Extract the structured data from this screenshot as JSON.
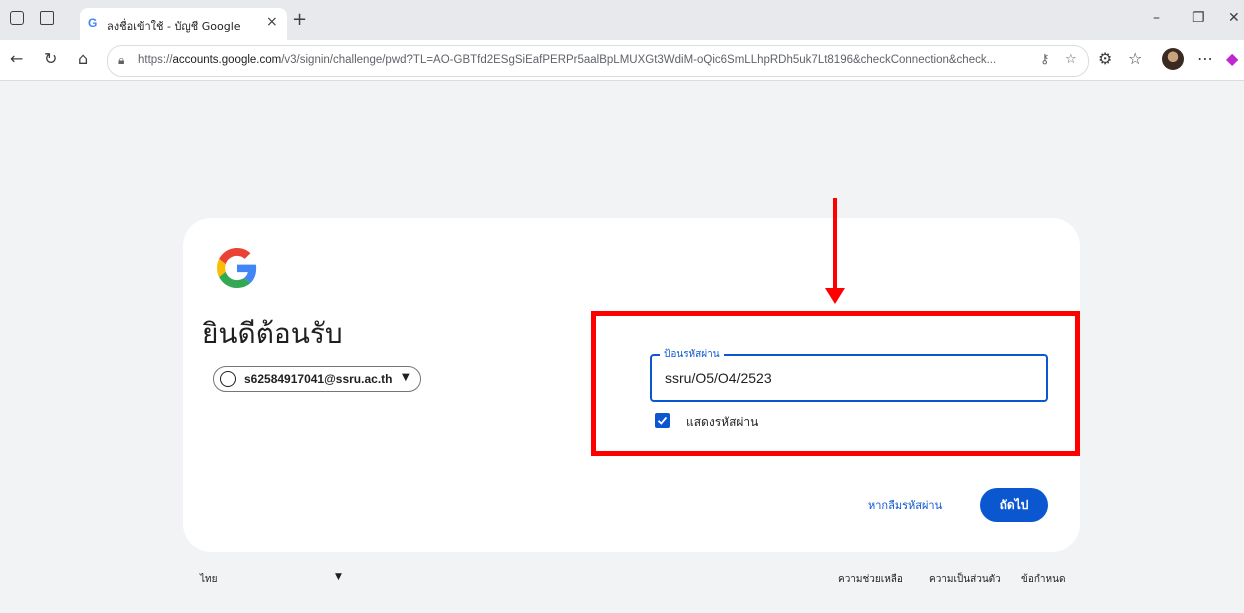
{
  "browser": {
    "tab_title": "ลงชื่อเข้าใช้ - บัญชี Google",
    "tab_close": "×",
    "new_tab": "+",
    "address_prefix": "https://",
    "address_host": "accounts.google.com",
    "address_path": "/v3/signin/challenge/pwd?TL=AO-GBTfd2ESgSiEafPERPr5aalBpLMUXGt3WdiM-oQic6SmLLhpRDh5uk7Lt8196&checkConnection&check...",
    "window_minimize": "–",
    "window_restore": "❐",
    "window_close": "✕"
  },
  "signin": {
    "welcome": "ยินดีต้อนรับ",
    "email": "s62584917041@ssru.ac.th",
    "password_label": "ป้อนรหัสผ่าน",
    "password_value": "ssru/O5/O4/2523",
    "show_password_label": "แสดงรหัสผ่าน",
    "show_password_checked": true,
    "forgot_password": "หากลืมรหัสผ่าน",
    "next_button": "ถัดไป"
  },
  "footer": {
    "language": "ไทย",
    "help": "ความช่วยเหลือ",
    "privacy": "ความเป็นส่วนตัว",
    "terms": "ข้อกำหนด"
  },
  "colors": {
    "accent": "#0b57d0",
    "annotation": "#ff0000",
    "card": "#ffffff",
    "page": "#f1f3f4"
  }
}
